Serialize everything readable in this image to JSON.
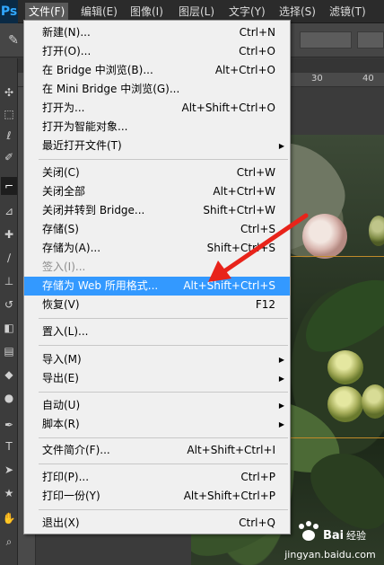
{
  "app": {
    "logo_text": "Ps",
    "accent_color": "#31a8ff"
  },
  "menubar": {
    "items": [
      {
        "label": "文件(F)",
        "active": true
      },
      {
        "label": "编辑(E)"
      },
      {
        "label": "图像(I)"
      },
      {
        "label": "图层(L)"
      },
      {
        "label": "文字(Y)"
      },
      {
        "label": "选择(S)"
      },
      {
        "label": "滤镜(T)"
      }
    ]
  },
  "ruler": {
    "top_numbers": [
      "30",
      "40"
    ]
  },
  "toolbox": {
    "tools": [
      "move-icon",
      "marquee-icon",
      "lasso-icon",
      "quick-select-icon",
      "crop-icon",
      "eyedropper-icon",
      "healing-icon",
      "brush-icon",
      "stamp-icon",
      "history-brush-icon",
      "eraser-icon",
      "gradient-icon",
      "blur-icon",
      "dodge-icon",
      "pen-icon",
      "type-icon",
      "path-select-icon",
      "shape-icon",
      "hand-icon",
      "zoom-icon"
    ]
  },
  "file_menu": {
    "highlight_color": "#3399ff",
    "items": [
      {
        "label": "新建(N)...",
        "shortcut": "Ctrl+N"
      },
      {
        "label": "打开(O)...",
        "shortcut": "Ctrl+O"
      },
      {
        "label": "在 Bridge 中浏览(B)...",
        "shortcut": "Alt+Ctrl+O"
      },
      {
        "label": "在 Mini Bridge 中浏览(G)...",
        "shortcut": ""
      },
      {
        "label": "打开为...",
        "shortcut": "Alt+Shift+Ctrl+O"
      },
      {
        "label": "打开为智能对象...",
        "shortcut": ""
      },
      {
        "label": "最近打开文件(T)",
        "shortcut": "",
        "submenu": true
      },
      {
        "separator": true
      },
      {
        "label": "关闭(C)",
        "shortcut": "Ctrl+W"
      },
      {
        "label": "关闭全部",
        "shortcut": "Alt+Ctrl+W"
      },
      {
        "label": "关闭并转到 Bridge...",
        "shortcut": "Shift+Ctrl+W"
      },
      {
        "label": "存储(S)",
        "shortcut": "Ctrl+S"
      },
      {
        "label": "存储为(A)...",
        "shortcut": "Shift+Ctrl+S"
      },
      {
        "label": "签入(I)...",
        "shortcut": "",
        "disabled": true
      },
      {
        "label": "存储为 Web 所用格式...",
        "shortcut": "Alt+Shift+Ctrl+S",
        "highlight": true
      },
      {
        "label": "恢复(V)",
        "shortcut": "F12"
      },
      {
        "separator": true
      },
      {
        "label": "置入(L)...",
        "shortcut": ""
      },
      {
        "separator": true
      },
      {
        "label": "导入(M)",
        "shortcut": "",
        "submenu": true
      },
      {
        "label": "导出(E)",
        "shortcut": "",
        "submenu": true
      },
      {
        "separator": true
      },
      {
        "label": "自动(U)",
        "shortcut": "",
        "submenu": true
      },
      {
        "label": "脚本(R)",
        "shortcut": "",
        "submenu": true
      },
      {
        "separator": true
      },
      {
        "label": "文件简介(F)...",
        "shortcut": "Alt+Shift+Ctrl+I"
      },
      {
        "separator": true
      },
      {
        "label": "打印(P)...",
        "shortcut": "Ctrl+P"
      },
      {
        "label": "打印一份(Y)",
        "shortcut": "Alt+Shift+Ctrl+P"
      },
      {
        "separator": true
      },
      {
        "label": "退出(X)",
        "shortcut": "Ctrl+Q"
      }
    ]
  },
  "annotation": {
    "arrow_color": "#e8231a"
  },
  "watermark": {
    "logo_text": "Baidu 经验",
    "text": "jingyan.baidu.com"
  }
}
